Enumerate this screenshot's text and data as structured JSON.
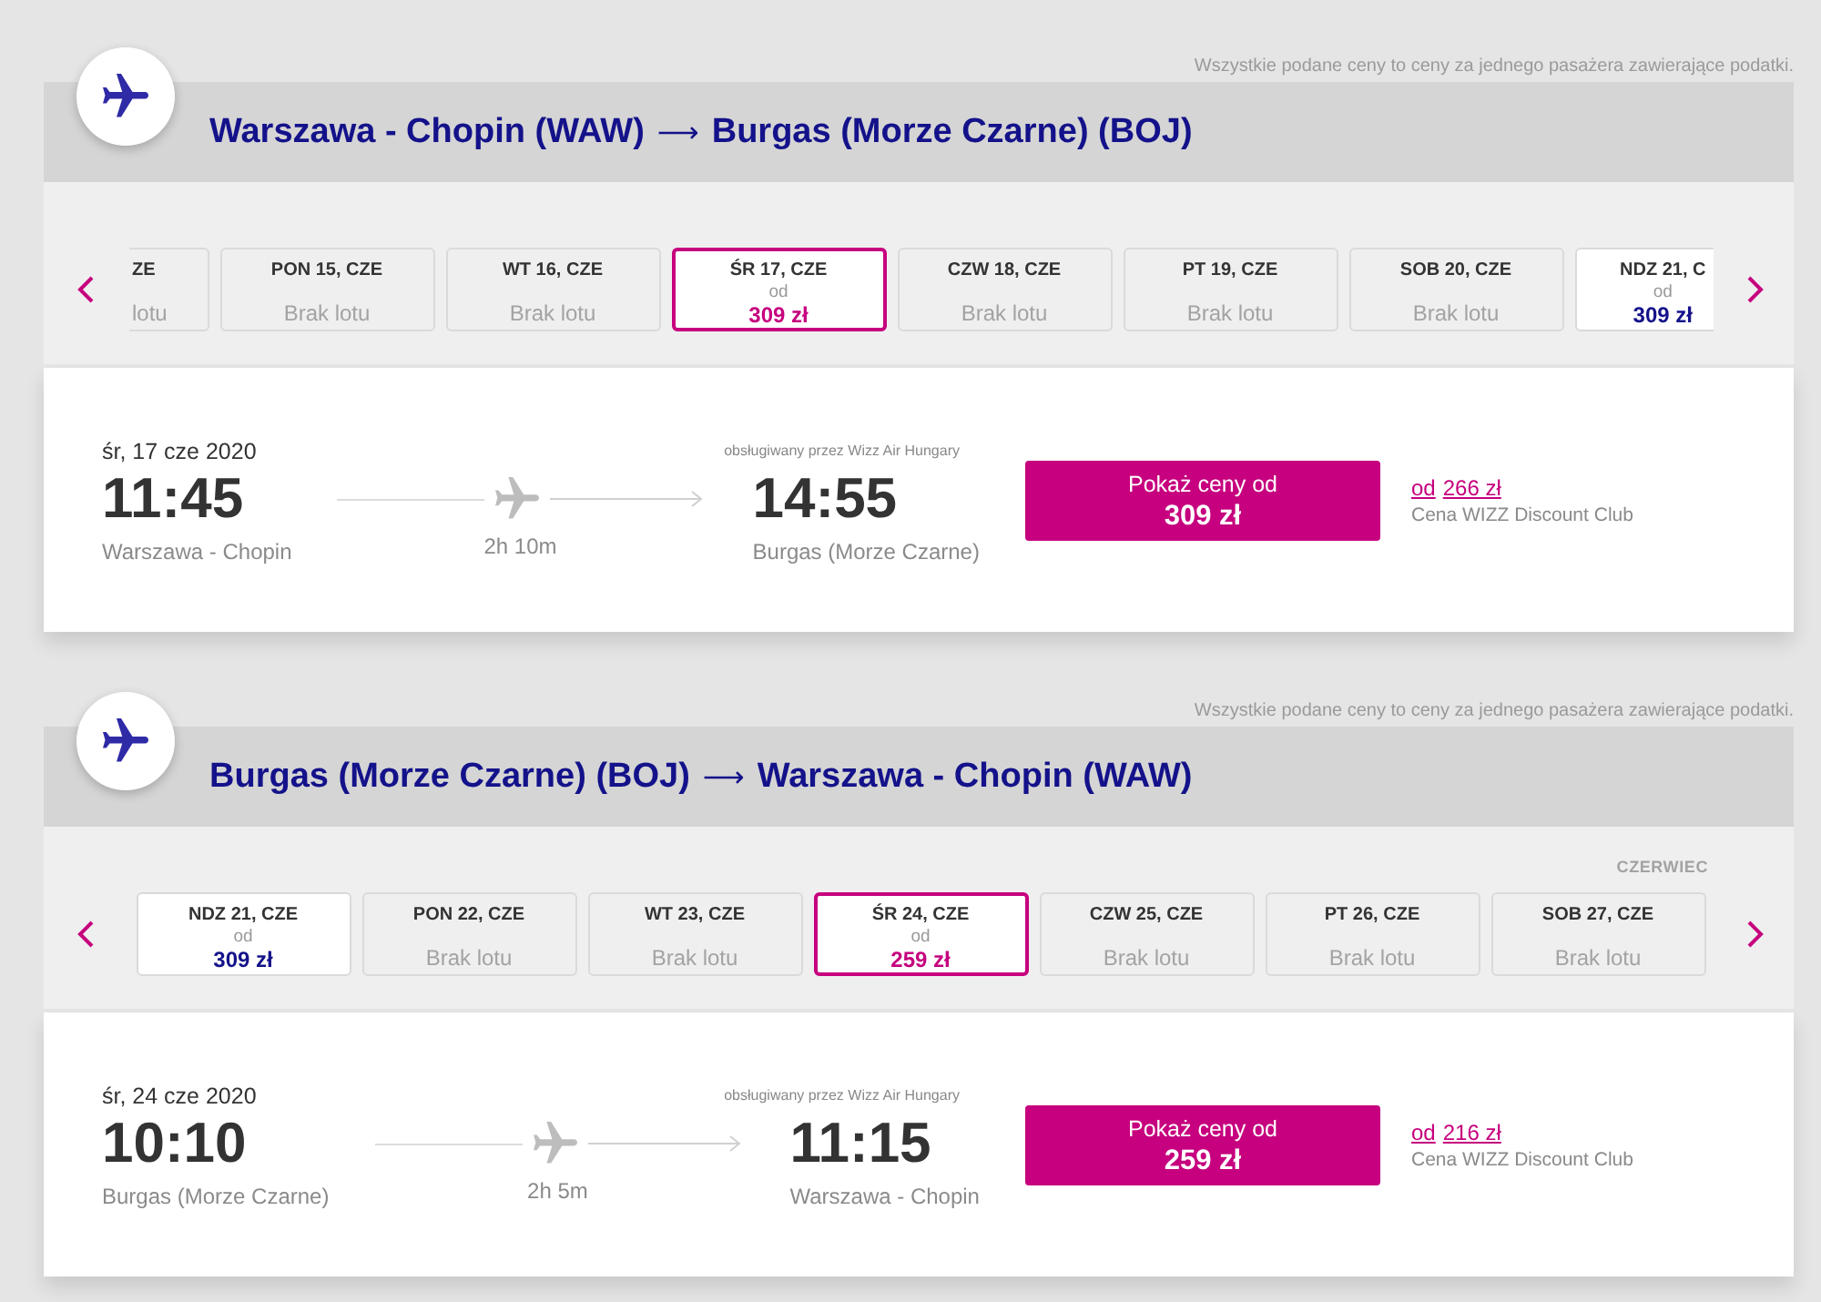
{
  "sections": [
    {
      "notice": "Wszystkie podane ceny to ceny za jednego pasażera zawierające podatki.",
      "route": {
        "origin": "Warszawa - Chopin (WAW)",
        "arrow": "⟶",
        "destination": "Burgas (Morze Czarne) (BOJ)"
      },
      "dates": {
        "days": [
          {
            "date": "ZE",
            "kind": "no-flight",
            "status": "lotu",
            "cut_left": true,
            "cut_right": false,
            "selected": false
          },
          {
            "date": "PON 15, CZE",
            "kind": "no-flight",
            "status": "Brak lotu",
            "cut_left": false,
            "cut_right": false,
            "selected": false
          },
          {
            "date": "WT 16, CZE",
            "kind": "no-flight",
            "status": "Brak lotu",
            "cut_left": false,
            "cut_right": false,
            "selected": false
          },
          {
            "date": "ŚR 17, CZE",
            "kind": "price",
            "from": "od",
            "price": "309 zł",
            "cut_left": false,
            "cut_right": false,
            "selected": true
          },
          {
            "date": "CZW 18, CZE",
            "kind": "no-flight",
            "status": "Brak lotu",
            "cut_left": false,
            "cut_right": false,
            "selected": false
          },
          {
            "date": "PT 19, CZE",
            "kind": "no-flight",
            "status": "Brak lotu",
            "cut_left": false,
            "cut_right": false,
            "selected": false
          },
          {
            "date": "SOB 20, CZE",
            "kind": "no-flight",
            "status": "Brak lotu",
            "cut_left": false,
            "cut_right": false,
            "selected": false
          },
          {
            "date": "NDZ 21, C",
            "kind": "price",
            "from": "od",
            "price": "309 zł",
            "cut_left": false,
            "cut_right": true,
            "selected": false
          }
        ]
      },
      "flight": {
        "date": "śr, 17 cze 2020",
        "operator": "obsługiwany przez Wizz Air Hungary",
        "departure": {
          "time": "11:45",
          "city": "Warszawa - Chopin"
        },
        "duration": "2h 10m",
        "arrival": {
          "time": "14:55",
          "city": "Burgas (Morze Czarne)"
        },
        "price_button": {
          "label": "Pokaż ceny od",
          "price": "309 zł"
        },
        "club": {
          "from": "od",
          "price": "266 zł",
          "label": "Cena WIZZ Discount Club"
        }
      }
    },
    {
      "notice": "Wszystkie podane ceny to ceny za jednego pasażera zawierające podatki.",
      "route": {
        "origin": "Burgas (Morze Czarne) (BOJ)",
        "arrow": "⟶",
        "destination": "Warszawa - Chopin (WAW)"
      },
      "dates": {
        "month": "CZERWIEC",
        "days": [
          {
            "date": "NDZ 21, CZE",
            "kind": "price",
            "from": "od",
            "price": "309 zł",
            "cut_left": false,
            "cut_right": false,
            "selected": false
          },
          {
            "date": "PON 22, CZE",
            "kind": "no-flight",
            "status": "Brak lotu",
            "cut_left": false,
            "cut_right": false,
            "selected": false
          },
          {
            "date": "WT 23, CZE",
            "kind": "no-flight",
            "status": "Brak lotu",
            "cut_left": false,
            "cut_right": false,
            "selected": false
          },
          {
            "date": "ŚR 24, CZE",
            "kind": "price",
            "from": "od",
            "price": "259 zł",
            "cut_left": false,
            "cut_right": false,
            "selected": true
          },
          {
            "date": "CZW 25, CZE",
            "kind": "no-flight",
            "status": "Brak lotu",
            "cut_left": false,
            "cut_right": false,
            "selected": false
          },
          {
            "date": "PT 26, CZE",
            "kind": "no-flight",
            "status": "Brak lotu",
            "cut_left": false,
            "cut_right": false,
            "selected": false
          },
          {
            "date": "SOB 27, CZE",
            "kind": "no-flight",
            "status": "Brak lotu",
            "cut_left": false,
            "cut_right": false,
            "selected": false
          }
        ]
      },
      "flight": {
        "date": "śr, 24 cze 2020",
        "operator": "obsługiwany przez Wizz Air Hungary",
        "departure": {
          "time": "10:10",
          "city": "Burgas (Morze Czarne)"
        },
        "duration": "2h 5m",
        "arrival": {
          "time": "11:15",
          "city": "Warszawa - Chopin"
        },
        "price_button": {
          "label": "Pokaż ceny od",
          "price": "259 zł"
        },
        "club": {
          "from": "od",
          "price": "216 zł",
          "label": "Cena WIZZ Discount Club"
        }
      }
    }
  ]
}
